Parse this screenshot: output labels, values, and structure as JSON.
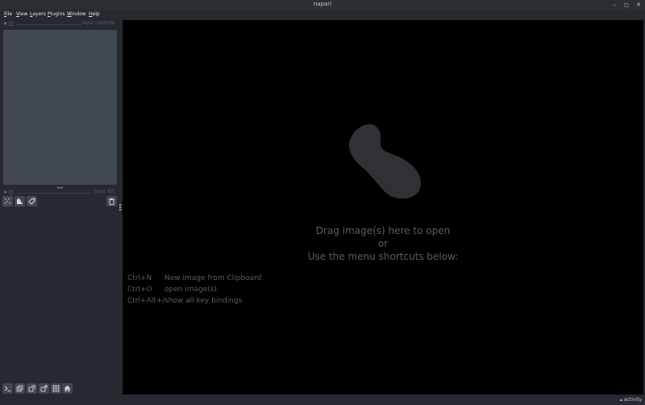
{
  "window": {
    "title": "napari",
    "minimize": "–",
    "maximize": "◻",
    "close": "✕"
  },
  "menu": [
    "File",
    "View",
    "Layers",
    "Plugins",
    "Window",
    "Help"
  ],
  "layer_controls": {
    "label": "layer controls"
  },
  "layer_list": {
    "label": "layer list",
    "handle": "•••"
  },
  "layer_buttons": {
    "new_points": "new-points-icon",
    "new_shapes": "new-shapes-icon",
    "new_labels": "new-labels-icon",
    "delete": "trash-icon"
  },
  "canvas": {
    "drag_line1": "Drag image(s) here to open",
    "drag_line2": "or",
    "drag_line3": "Use the menu shortcuts below:",
    "shortcuts": [
      {
        "key": "Ctrl+N",
        "desc": "New Image from Clipboard"
      },
      {
        "key": "Ctrl+O",
        "desc": "open image(s)"
      },
      {
        "key": "Ctrl+Alt+/",
        "desc": "show all key bindings"
      }
    ]
  },
  "viewer_buttons": [
    "console-icon",
    "ndisplay-icon",
    "roll-icon",
    "transpose-icon",
    "grid-icon",
    "home-icon"
  ],
  "status": {
    "activity": "▴ activity"
  },
  "colors": {
    "panel": "#262930",
    "control": "#414851",
    "canvas": "#000000",
    "logo": "#2f3135"
  }
}
